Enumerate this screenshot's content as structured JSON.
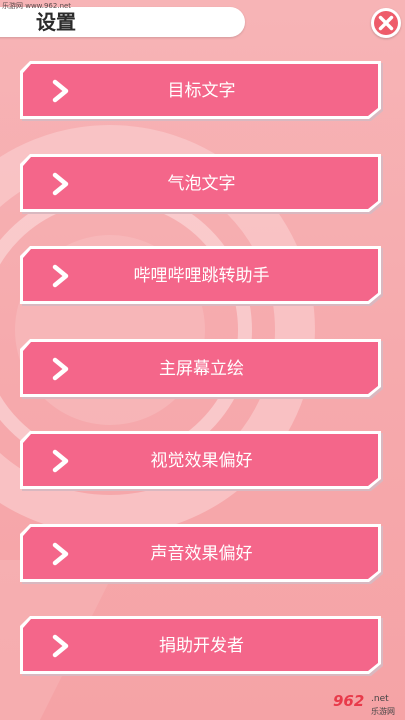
{
  "watermark": {
    "top_text": "乐游网 www.962.net",
    "bottom_number": "962",
    "bottom_domain": ".net",
    "bottom_cn": "乐游网"
  },
  "header": {
    "title": "设置",
    "close_icon": "close-x-icon"
  },
  "menu": {
    "items": [
      {
        "label": "目标文字",
        "icon": "chevron-right-icon"
      },
      {
        "label": "气泡文字",
        "icon": "chevron-right-icon"
      },
      {
        "label": "哔哩哔哩跳转助手",
        "icon": "chevron-right-icon"
      },
      {
        "label": "主屏幕立绘",
        "icon": "chevron-right-icon"
      },
      {
        "label": "视觉效果偏好",
        "icon": "chevron-right-icon"
      },
      {
        "label": "声音效果偏好",
        "icon": "chevron-right-icon"
      },
      {
        "label": "捐助开发者",
        "icon": "chevron-right-icon"
      }
    ]
  },
  "colors": {
    "background": "#f7b0b3",
    "button_fill": "#f4668a",
    "button_border": "#ffffff",
    "button_shadow": "#d9b8c0",
    "close_red": "#ee5c6a"
  }
}
